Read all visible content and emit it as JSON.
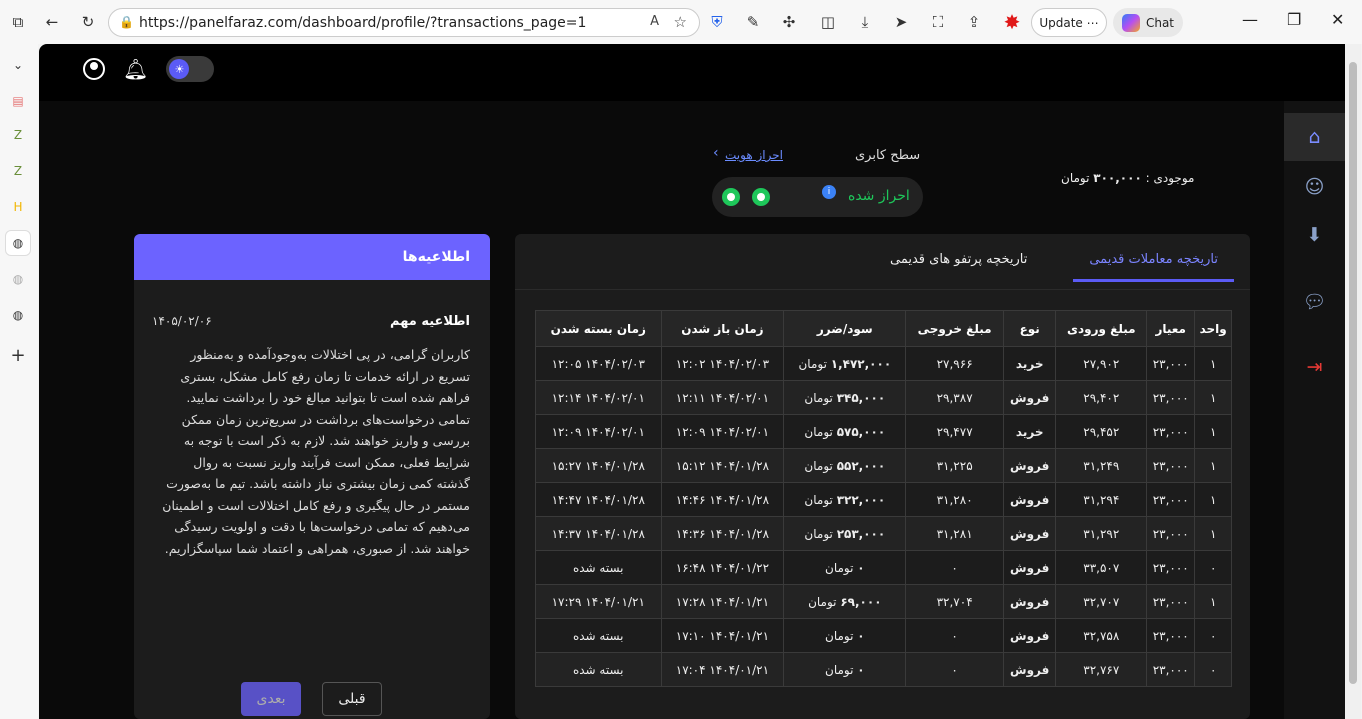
{
  "browser": {
    "url": "https://panelfaraz.com/dashboard/profile/?transactions_page=1",
    "update_label": "Update",
    "chat_label": "Chat"
  },
  "header": {
    "user_level_label": "سطح کابری",
    "verify_link": "احراز هویت",
    "verified_label": "احراز شده",
    "balance_label": "موجودی :",
    "balance_value": "۳۰۰,۰۰۰",
    "balance_unit": "تومان"
  },
  "announcements": {
    "panel_title": "اطلاعیه‌ها",
    "title": "اطلاعیه مهم",
    "date": "۱۴۰۵/۰۲/۰۶",
    "body": "کاربران گرامی، در پی اختلالات به‌وجودآمده و به‌منظور تسریع در ارائه خدمات تا زمان رفع کامل مشکل، بستری فراهم شده است تا بتوانید مبالغ خود را برداشت نمایید. تمامی درخواست‌های برداشت در سریع‌ترین زمان ممکن بررسی و واریز خواهند شد. لازم به ذکر است با توجه به شرایط فعلی، ممکن است فرآیند واریز نسبت به روال گذشته کمی زمان بیشتری نیاز داشته باشد. تیم ما به‌صورت مستمر در حال پیگیری و رفع کامل اختلالات است و اطمینان می‌دهیم که تمامی درخواست‌ها با دقت و اولویت رسیدگی خواهند شد. از صبوری، همراهی و اعتماد شما سپاسگزاریم.",
    "next_label": "بعدی",
    "prev_label": "قبلی"
  },
  "transactions": {
    "tabs": [
      "تاریخچه معاملات قدیمی",
      "تاریخچه پرتفو های قدیمی"
    ],
    "columns": [
      "واحد",
      "معیار",
      "مبلغ ورودی",
      "نوع",
      "مبلغ خروجی",
      "سود/ضرر",
      "زمان باز شدن",
      "زمان بسته شدن"
    ],
    "currency": "تومان",
    "rows": [
      {
        "unit": "۱",
        "rate": "۲۳,۰۰۰",
        "in": "۲۷,۹۰۲",
        "type": "خرید",
        "kind": "buy",
        "out": "۲۷,۹۶۶",
        "pl": "۱,۴۷۲,۰۰۰",
        "open": "۱۴۰۴/۰۲/۰۳ ۱۲:۰۲",
        "close": "۱۴۰۴/۰۲/۰۳ ۱۲:۰۵"
      },
      {
        "unit": "۱",
        "rate": "۲۳,۰۰۰",
        "in": "۲۹,۴۰۲",
        "type": "فروش",
        "kind": "sell",
        "out": "۲۹,۳۸۷",
        "pl": "۳۴۵,۰۰۰",
        "open": "۱۴۰۴/۰۲/۰۱ ۱۲:۱۱",
        "close": "۱۴۰۴/۰۲/۰۱ ۱۲:۱۴"
      },
      {
        "unit": "۱",
        "rate": "۲۳,۰۰۰",
        "in": "۲۹,۴۵۲",
        "type": "خرید",
        "kind": "buy",
        "out": "۲۹,۴۷۷",
        "pl": "۵۷۵,۰۰۰",
        "open": "۱۴۰۴/۰۲/۰۱ ۱۲:۰۹",
        "close": "۱۴۰۴/۰۲/۰۱ ۱۲:۰۹"
      },
      {
        "unit": "۱",
        "rate": "۲۳,۰۰۰",
        "in": "۳۱,۲۴۹",
        "type": "فروش",
        "kind": "sell",
        "out": "۳۱,۲۲۵",
        "pl": "۵۵۲,۰۰۰",
        "open": "۱۴۰۴/۰۱/۲۸ ۱۵:۱۲",
        "close": "۱۴۰۴/۰۱/۲۸ ۱۵:۲۷"
      },
      {
        "unit": "۱",
        "rate": "۲۳,۰۰۰",
        "in": "۳۱,۲۹۴",
        "type": "فروش",
        "kind": "sell",
        "out": "۳۱,۲۸۰",
        "pl": "۳۲۲,۰۰۰",
        "open": "۱۴۰۴/۰۱/۲۸ ۱۴:۴۶",
        "close": "۱۴۰۴/۰۱/۲۸ ۱۴:۴۷"
      },
      {
        "unit": "۱",
        "rate": "۲۳,۰۰۰",
        "in": "۳۱,۲۹۲",
        "type": "فروش",
        "kind": "sell",
        "out": "۳۱,۲۸۱",
        "pl": "۲۵۳,۰۰۰",
        "open": "۱۴۰۴/۰۱/۲۸ ۱۴:۳۶",
        "close": "۱۴۰۴/۰۱/۲۸ ۱۴:۳۷"
      },
      {
        "unit": "۰",
        "rate": "۲۳,۰۰۰",
        "in": "۳۳,۵۰۷",
        "type": "فروش",
        "kind": "sell",
        "out": "۰",
        "pl": "۰",
        "open": "۱۴۰۴/۰۱/۲۲ ۱۶:۴۸",
        "close": "بسته شده"
      },
      {
        "unit": "۱",
        "rate": "۲۳,۰۰۰",
        "in": "۳۲,۷۰۷",
        "type": "فروش",
        "kind": "sell",
        "out": "۳۲,۷۰۴",
        "pl": "۶۹,۰۰۰",
        "open": "۱۴۰۴/۰۱/۲۱ ۱۷:۲۸",
        "close": "۱۴۰۴/۰۱/۲۱ ۱۷:۲۹"
      },
      {
        "unit": "۰",
        "rate": "۲۳,۰۰۰",
        "in": "۳۲,۷۵۸",
        "type": "فروش",
        "kind": "sell",
        "out": "۰",
        "pl": "۰",
        "open": "۱۴۰۴/۰۱/۲۱ ۱۷:۱۰",
        "close": "بسته شده"
      },
      {
        "unit": "۰",
        "rate": "۲۳,۰۰۰",
        "in": "۳۲,۷۶۷",
        "type": "فروش",
        "kind": "sell",
        "out": "۰",
        "pl": "۰",
        "open": "۱۴۰۴/۰۱/۲۱ ۱۷:۰۴",
        "close": "بسته شده"
      }
    ]
  },
  "colors": {
    "accent": "#6c63ff",
    "buy": "#1ec75a",
    "sell": "#ff3b3b"
  }
}
